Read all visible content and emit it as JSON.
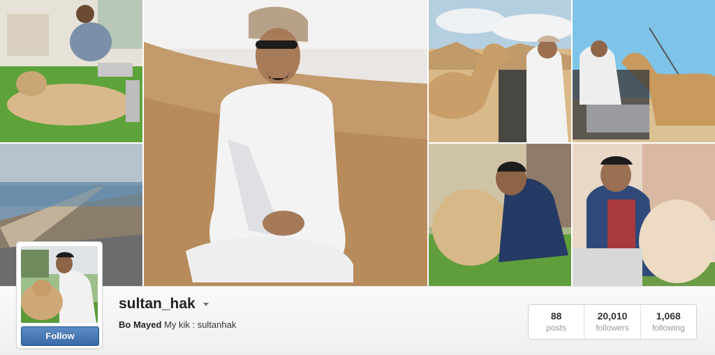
{
  "profile": {
    "username": "sultan_hak",
    "full_name": "Bo Mayed",
    "bio": "My kik : sultanhak",
    "follow_label": "Follow"
  },
  "stats": [
    {
      "count": "88",
      "label": "posts"
    },
    {
      "count": "20,010",
      "label": "followers"
    },
    {
      "count": "1,068",
      "label": "following"
    }
  ],
  "colors": {
    "follow_button": "#3a6aa7",
    "page_background": "#f3f3f3"
  },
  "icons": {
    "username_menu": "chevron-down-icon"
  }
}
